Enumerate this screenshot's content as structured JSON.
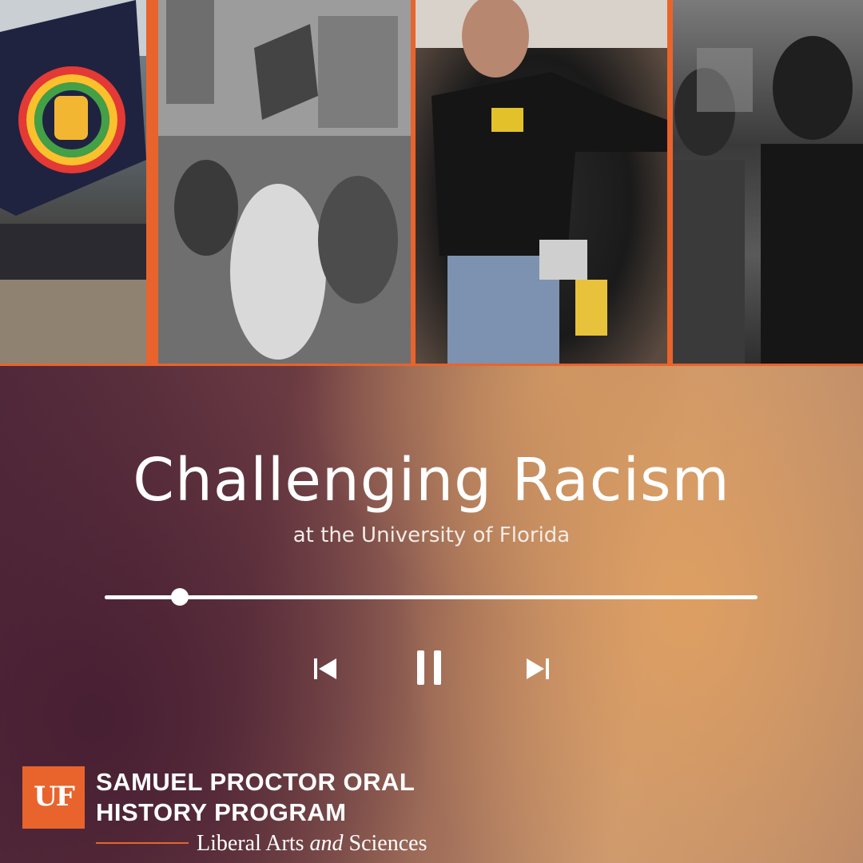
{
  "header": {
    "photos": [
      {
        "name": "pride-protest-photo"
      },
      {
        "name": "campus-sit-in-photo"
      },
      {
        "name": "speaker-microphone-photo"
      },
      {
        "name": "rally-crowd-photo"
      }
    ]
  },
  "main": {
    "title": "Challenging Racism",
    "subtitle": "at the University of Florida"
  },
  "player": {
    "progress": 0.115,
    "controls": [
      "previous-icon",
      "pause-icon",
      "next-icon"
    ]
  },
  "footer": {
    "logo_text": "UF",
    "org_line1": "SAMUEL PROCTOR ORAL",
    "org_line2": "HISTORY PROGRAM",
    "college_prefix": "Liberal Arts ",
    "college_and": "and",
    "college_suffix": " Sciences"
  },
  "colors": {
    "accent": "#e8642c",
    "text": "#ffffff"
  }
}
